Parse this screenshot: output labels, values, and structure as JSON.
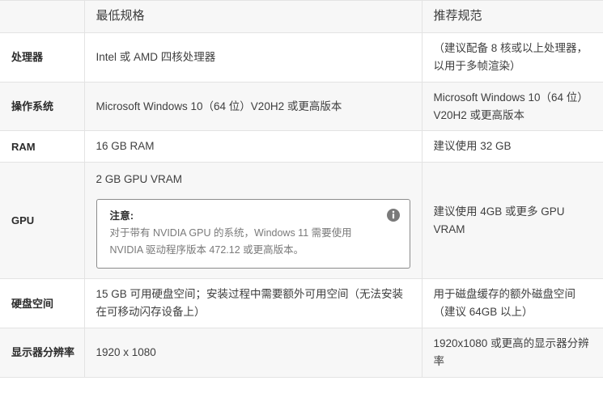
{
  "table": {
    "columns": [
      {
        "key": "label",
        "label": ""
      },
      {
        "key": "minimum",
        "label": "最低规格"
      },
      {
        "key": "recommended",
        "label": "推荐规范"
      }
    ],
    "rows": [
      {
        "label": "处理器",
        "minimum": "Intel 或 AMD 四核处理器",
        "recommended": "（建议配备 8 核或以上处理器，以用于多帧渲染）"
      },
      {
        "label": "操作系统",
        "minimum": "Microsoft Windows 10（64 位）V20H2 或更高版本",
        "recommended": "Microsoft Windows 10（64 位）V20H2 或更高版本"
      },
      {
        "label": "RAM",
        "minimum": "16 GB RAM",
        "recommended": "建议使用 32 GB"
      },
      {
        "label": "GPU",
        "minimum": "2 GB GPU VRAM",
        "recommended": "建议使用 4GB 或更多 GPU VRAM",
        "note": {
          "title": "注意:",
          "body": "对于带有 NVIDIA GPU 的系统，Windows 11 需要使用 NVIDIA 驱动程序版本 472.12 或更高版本。",
          "icon": "info-icon"
        }
      },
      {
        "label": "硬盘空间",
        "minimum": "15 GB 可用硬盘空间；安装过程中需要额外可用空间（无法安装在可移动闪存设备上）",
        "recommended": "用于磁盘缓存的额外磁盘空间（建议 64GB 以上）"
      },
      {
        "label": "显示器分辨率",
        "minimum": "1920 x 1080",
        "recommended": "1920x1080 或更高的显示器分辨率"
      }
    ]
  },
  "colors": {
    "header_bg": "#f7f7f7",
    "row_shaded_bg": "#f7f7f7",
    "row_plain_bg": "#ffffff",
    "border": "#e3e3e3",
    "note_border": "#8c8c8c",
    "note_text": "#7a7a7a",
    "text": "#3f3f3f",
    "icon_fill": "#7a7a7a"
  }
}
